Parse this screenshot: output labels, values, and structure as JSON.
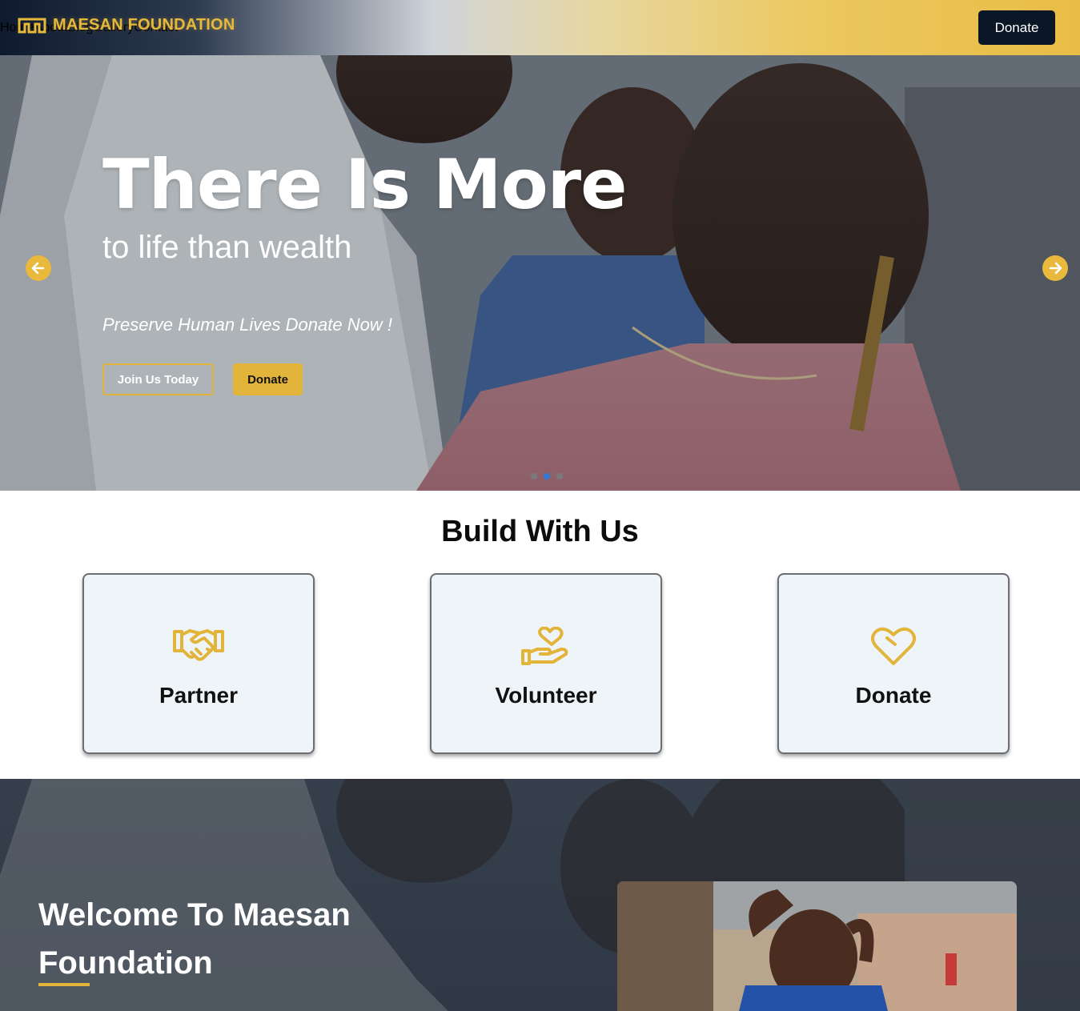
{
  "brand": {
    "name": "MAESAN FOUNDATION",
    "accent": "#e3b43a"
  },
  "nav": {
    "items": [
      "Home",
      "About",
      "Blog",
      "Gallery",
      "Contact"
    ],
    "donate_label": "Donate"
  },
  "hero": {
    "title": "There Is More",
    "subtitle": "to life than wealth",
    "tagline": "Preserve Human Lives Donate Now !",
    "join_label": "Join Us Today",
    "donate_label": "Donate",
    "slide_count": 3,
    "active_slide": 2
  },
  "build": {
    "title": "Build With Us",
    "cards": [
      {
        "label": "Partner",
        "icon": "handshake-icon"
      },
      {
        "label": "Volunteer",
        "icon": "hand-heart-icon"
      },
      {
        "label": "Donate",
        "icon": "heart-icon"
      }
    ]
  },
  "welcome": {
    "title": "Welcome To Maesan Foundation"
  }
}
